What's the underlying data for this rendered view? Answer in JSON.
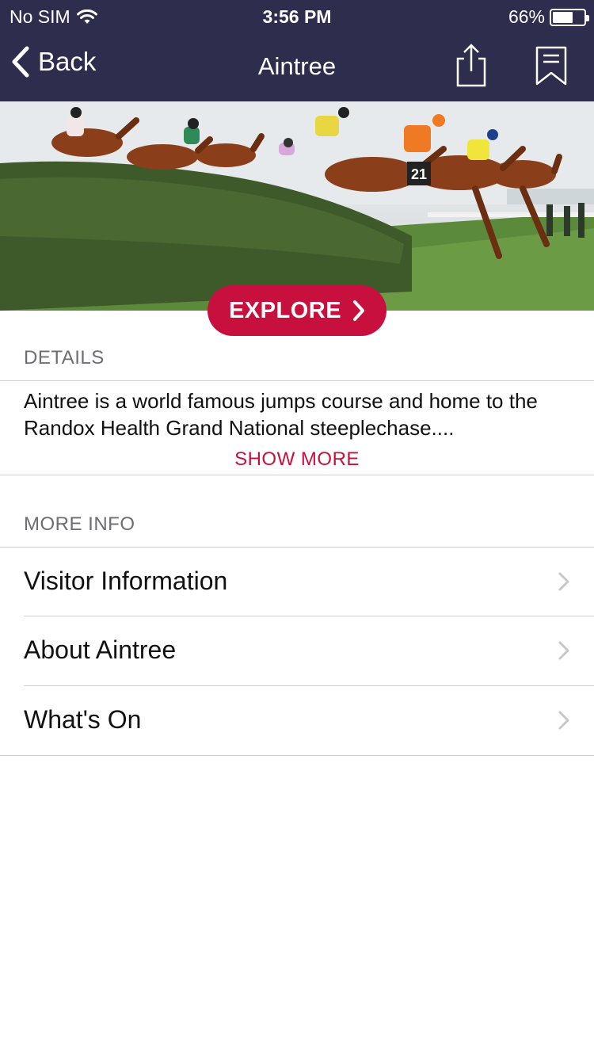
{
  "status_bar": {
    "carrier": "No SIM",
    "time": "3:56 PM",
    "battery_text": "66%",
    "battery_level": 0.66
  },
  "nav": {
    "back_label": "Back",
    "title": "Aintree",
    "share_icon": "share-icon",
    "bookmark_icon": "bookmark-icon"
  },
  "hero": {
    "explore_label": "EXPLORE"
  },
  "details": {
    "header": "DETAILS",
    "text": "Aintree is a world famous jumps course and home to the Randox Health Grand National steeplechase....",
    "show_more_label": "SHOW MORE"
  },
  "more_info": {
    "header": "MORE INFO",
    "items": [
      {
        "label": "Visitor Information"
      },
      {
        "label": "About Aintree"
      },
      {
        "label": "What's On"
      }
    ]
  },
  "colors": {
    "nav_background": "#2f2d4e",
    "accent": "#c8103e",
    "section_header": "#6d6d72"
  }
}
